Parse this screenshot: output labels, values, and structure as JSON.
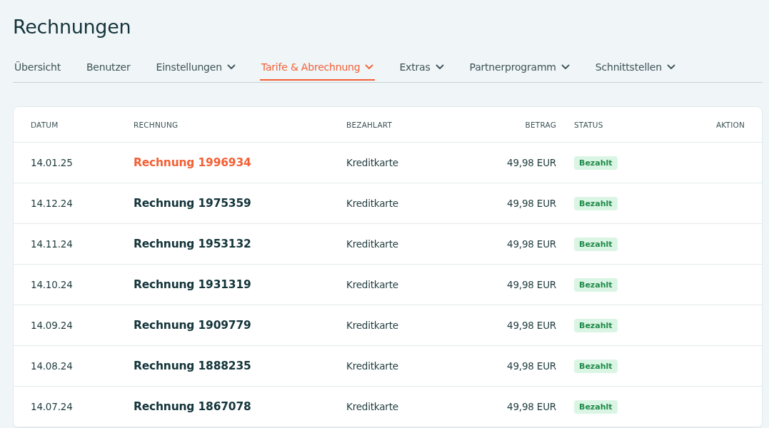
{
  "page_title": "Rechnungen",
  "tabs": [
    {
      "label": "Übersicht",
      "selected": false,
      "has_dropdown": false
    },
    {
      "label": "Benutzer",
      "selected": false,
      "has_dropdown": false
    },
    {
      "label": "Einstellungen",
      "selected": false,
      "has_dropdown": true
    },
    {
      "label": "Tarife & Abrechnung",
      "selected": true,
      "has_dropdown": true
    },
    {
      "label": "Extras",
      "selected": false,
      "has_dropdown": true
    },
    {
      "label": "Partnerprogramm",
      "selected": false,
      "has_dropdown": true
    },
    {
      "label": "Schnittstellen",
      "selected": false,
      "has_dropdown": true
    }
  ],
  "table": {
    "columns": [
      "DATUM",
      "RECHNUNG",
      "BEZAHLART",
      "BETRAG",
      "STATUS",
      "AKTION"
    ],
    "rows": [
      {
        "date": "14.01.25",
        "invoice": "Rechnung 1996934",
        "highlighted": true,
        "payment": "Kreditkarte",
        "amount": "49,98 EUR",
        "status": "Bezahlt"
      },
      {
        "date": "14.12.24",
        "invoice": "Rechnung 1975359",
        "highlighted": false,
        "payment": "Kreditkarte",
        "amount": "49,98 EUR",
        "status": "Bezahlt"
      },
      {
        "date": "14.11.24",
        "invoice": "Rechnung 1953132",
        "highlighted": false,
        "payment": "Kreditkarte",
        "amount": "49,98 EUR",
        "status": "Bezahlt"
      },
      {
        "date": "14.10.24",
        "invoice": "Rechnung 1931319",
        "highlighted": false,
        "payment": "Kreditkarte",
        "amount": "49,98 EUR",
        "status": "Bezahlt"
      },
      {
        "date": "14.09.24",
        "invoice": "Rechnung 1909779",
        "highlighted": false,
        "payment": "Kreditkarte",
        "amount": "49,98 EUR",
        "status": "Bezahlt"
      },
      {
        "date": "14.08.24",
        "invoice": "Rechnung 1888235",
        "highlighted": false,
        "payment": "Kreditkarte",
        "amount": "49,98 EUR",
        "status": "Bezahlt"
      },
      {
        "date": "14.07.24",
        "invoice": "Rechnung 1867078",
        "highlighted": false,
        "payment": "Kreditkarte",
        "amount": "49,98 EUR",
        "status": "Bezahlt"
      }
    ]
  }
}
